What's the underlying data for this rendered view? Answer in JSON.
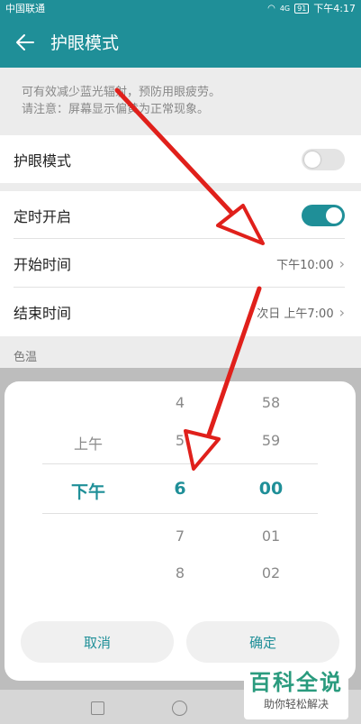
{
  "statusbar": {
    "carrier": "中国联通",
    "signal": "4G",
    "battery": "91",
    "time": "下午4:17"
  },
  "appbar": {
    "title": "护眼模式"
  },
  "description": {
    "line1": "可有效减少蓝光辐射，预防用眼疲劳。",
    "line2": "请注意：屏幕显示偏黄为正常现象。"
  },
  "eye_mode": {
    "label": "护眼模式",
    "enabled": false
  },
  "schedule": {
    "label": "定时开启",
    "enabled": true,
    "start_label": "开始时间",
    "start_value": "下午10:00",
    "end_label": "结束时间",
    "end_value": "次日 上午7:00"
  },
  "color_temp": {
    "label": "色温"
  },
  "picker": {
    "ampm": {
      "above": "上午",
      "selected": "下午"
    },
    "hours": {
      "above2": "4",
      "above1": "5",
      "selected": "6",
      "below1": "7",
      "below2": "8"
    },
    "minutes": {
      "above2": "58",
      "above1": "59",
      "selected": "00",
      "below1": "01",
      "below2": "02"
    },
    "cancel_label": "取消",
    "ok_label": "确定"
  },
  "watermark": {
    "title": "百科全说",
    "subtitle": "助你轻松解决"
  },
  "colors": {
    "primary": "#1f8f98",
    "arrow": "#e0201b"
  }
}
